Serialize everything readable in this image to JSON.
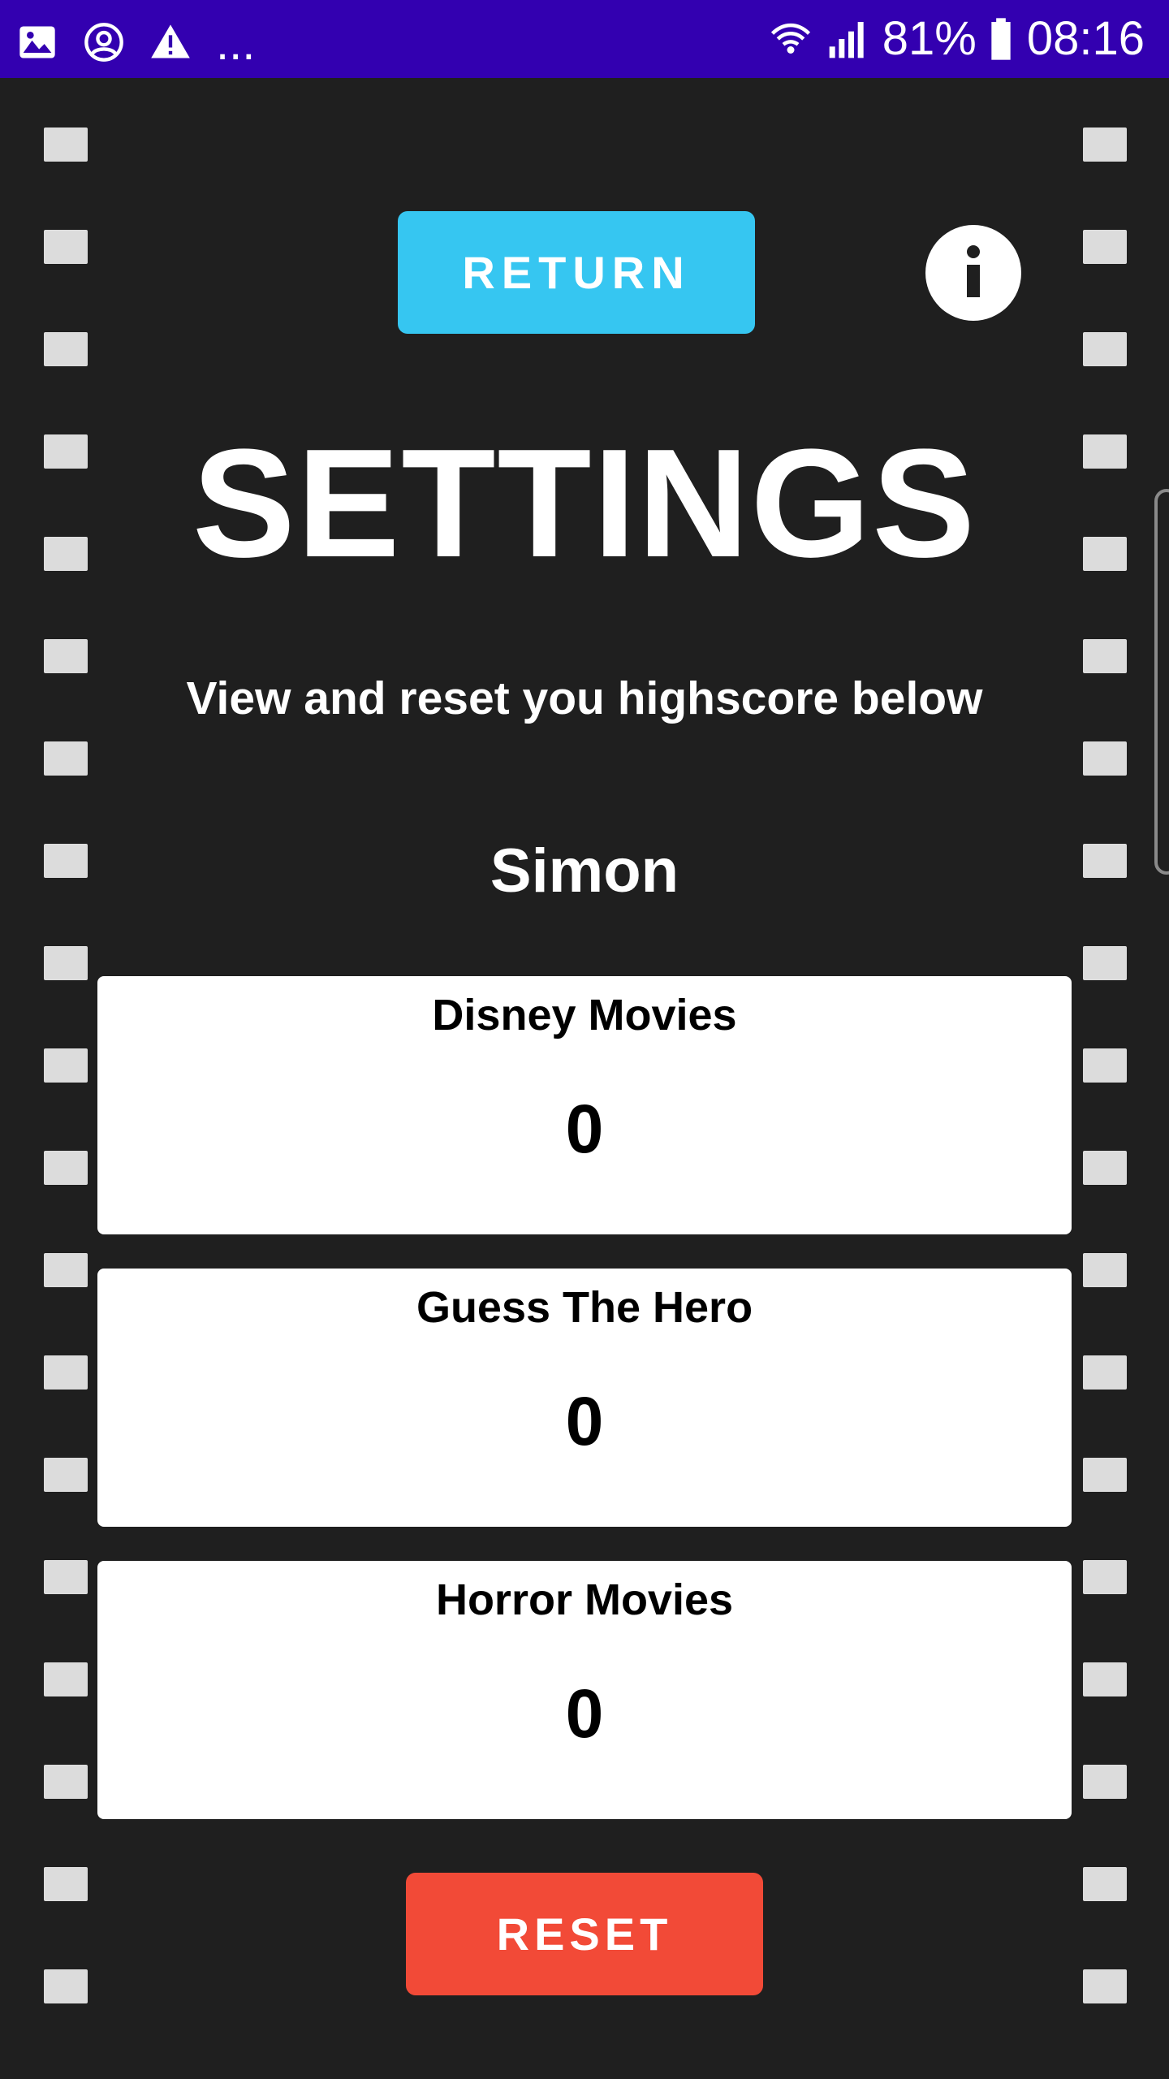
{
  "status_bar": {
    "icons_left": [
      "image-icon",
      "account-circle-icon",
      "warning-icon"
    ],
    "overflow": "...",
    "battery_percent": "81%",
    "time": "08:16",
    "background_color": "#3300b0"
  },
  "header": {
    "return_label": "RETURN",
    "return_color": "#36c6f1",
    "info_label": "i"
  },
  "title": "SETTINGS",
  "subtitle": "View and reset you highscore below",
  "player_name": "Simon",
  "scores": [
    {
      "category": "Disney Movies",
      "score": "0"
    },
    {
      "category": "Guess The Hero",
      "score": "0"
    },
    {
      "category": "Horror Movies",
      "score": "0"
    }
  ],
  "reset_label": "RESET",
  "reset_color": "#f24a37"
}
